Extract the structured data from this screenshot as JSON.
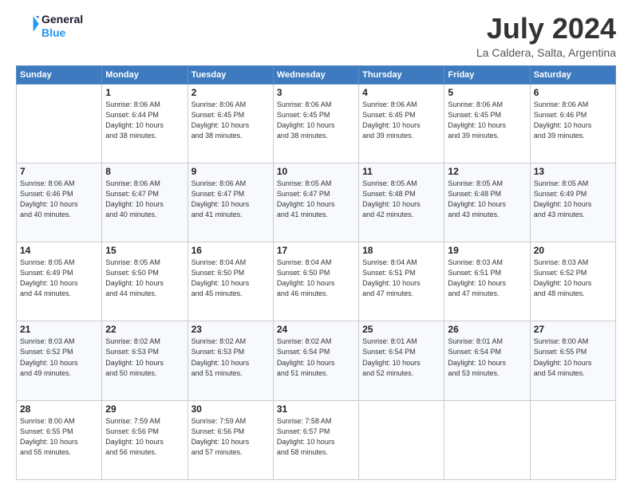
{
  "header": {
    "logo_line1": "General",
    "logo_line2": "Blue",
    "month_year": "July 2024",
    "location": "La Caldera, Salta, Argentina"
  },
  "weekdays": [
    "Sunday",
    "Monday",
    "Tuesday",
    "Wednesday",
    "Thursday",
    "Friday",
    "Saturday"
  ],
  "weeks": [
    [
      {
        "day": "",
        "sunrise": "",
        "sunset": "",
        "daylight": ""
      },
      {
        "day": "1",
        "sunrise": "Sunrise: 8:06 AM",
        "sunset": "Sunset: 6:44 PM",
        "daylight": "Daylight: 10 hours and 38 minutes."
      },
      {
        "day": "2",
        "sunrise": "Sunrise: 8:06 AM",
        "sunset": "Sunset: 6:45 PM",
        "daylight": "Daylight: 10 hours and 38 minutes."
      },
      {
        "day": "3",
        "sunrise": "Sunrise: 8:06 AM",
        "sunset": "Sunset: 6:45 PM",
        "daylight": "Daylight: 10 hours and 38 minutes."
      },
      {
        "day": "4",
        "sunrise": "Sunrise: 8:06 AM",
        "sunset": "Sunset: 6:45 PM",
        "daylight": "Daylight: 10 hours and 39 minutes."
      },
      {
        "day": "5",
        "sunrise": "Sunrise: 8:06 AM",
        "sunset": "Sunset: 6:45 PM",
        "daylight": "Daylight: 10 hours and 39 minutes."
      },
      {
        "day": "6",
        "sunrise": "Sunrise: 8:06 AM",
        "sunset": "Sunset: 6:46 PM",
        "daylight": "Daylight: 10 hours and 39 minutes."
      }
    ],
    [
      {
        "day": "7",
        "sunrise": "Sunrise: 8:06 AM",
        "sunset": "Sunset: 6:46 PM",
        "daylight": "Daylight: 10 hours and 40 minutes."
      },
      {
        "day": "8",
        "sunrise": "Sunrise: 8:06 AM",
        "sunset": "Sunset: 6:47 PM",
        "daylight": "Daylight: 10 hours and 40 minutes."
      },
      {
        "day": "9",
        "sunrise": "Sunrise: 8:06 AM",
        "sunset": "Sunset: 6:47 PM",
        "daylight": "Daylight: 10 hours and 41 minutes."
      },
      {
        "day": "10",
        "sunrise": "Sunrise: 8:05 AM",
        "sunset": "Sunset: 6:47 PM",
        "daylight": "Daylight: 10 hours and 41 minutes."
      },
      {
        "day": "11",
        "sunrise": "Sunrise: 8:05 AM",
        "sunset": "Sunset: 6:48 PM",
        "daylight": "Daylight: 10 hours and 42 minutes."
      },
      {
        "day": "12",
        "sunrise": "Sunrise: 8:05 AM",
        "sunset": "Sunset: 6:48 PM",
        "daylight": "Daylight: 10 hours and 43 minutes."
      },
      {
        "day": "13",
        "sunrise": "Sunrise: 8:05 AM",
        "sunset": "Sunset: 6:49 PM",
        "daylight": "Daylight: 10 hours and 43 minutes."
      }
    ],
    [
      {
        "day": "14",
        "sunrise": "Sunrise: 8:05 AM",
        "sunset": "Sunset: 6:49 PM",
        "daylight": "Daylight: 10 hours and 44 minutes."
      },
      {
        "day": "15",
        "sunrise": "Sunrise: 8:05 AM",
        "sunset": "Sunset: 6:50 PM",
        "daylight": "Daylight: 10 hours and 44 minutes."
      },
      {
        "day": "16",
        "sunrise": "Sunrise: 8:04 AM",
        "sunset": "Sunset: 6:50 PM",
        "daylight": "Daylight: 10 hours and 45 minutes."
      },
      {
        "day": "17",
        "sunrise": "Sunrise: 8:04 AM",
        "sunset": "Sunset: 6:50 PM",
        "daylight": "Daylight: 10 hours and 46 minutes."
      },
      {
        "day": "18",
        "sunrise": "Sunrise: 8:04 AM",
        "sunset": "Sunset: 6:51 PM",
        "daylight": "Daylight: 10 hours and 47 minutes."
      },
      {
        "day": "19",
        "sunrise": "Sunrise: 8:03 AM",
        "sunset": "Sunset: 6:51 PM",
        "daylight": "Daylight: 10 hours and 47 minutes."
      },
      {
        "day": "20",
        "sunrise": "Sunrise: 8:03 AM",
        "sunset": "Sunset: 6:52 PM",
        "daylight": "Daylight: 10 hours and 48 minutes."
      }
    ],
    [
      {
        "day": "21",
        "sunrise": "Sunrise: 8:03 AM",
        "sunset": "Sunset: 6:52 PM",
        "daylight": "Daylight: 10 hours and 49 minutes."
      },
      {
        "day": "22",
        "sunrise": "Sunrise: 8:02 AM",
        "sunset": "Sunset: 6:53 PM",
        "daylight": "Daylight: 10 hours and 50 minutes."
      },
      {
        "day": "23",
        "sunrise": "Sunrise: 8:02 AM",
        "sunset": "Sunset: 6:53 PM",
        "daylight": "Daylight: 10 hours and 51 minutes."
      },
      {
        "day": "24",
        "sunrise": "Sunrise: 8:02 AM",
        "sunset": "Sunset: 6:54 PM",
        "daylight": "Daylight: 10 hours and 51 minutes."
      },
      {
        "day": "25",
        "sunrise": "Sunrise: 8:01 AM",
        "sunset": "Sunset: 6:54 PM",
        "daylight": "Daylight: 10 hours and 52 minutes."
      },
      {
        "day": "26",
        "sunrise": "Sunrise: 8:01 AM",
        "sunset": "Sunset: 6:54 PM",
        "daylight": "Daylight: 10 hours and 53 minutes."
      },
      {
        "day": "27",
        "sunrise": "Sunrise: 8:00 AM",
        "sunset": "Sunset: 6:55 PM",
        "daylight": "Daylight: 10 hours and 54 minutes."
      }
    ],
    [
      {
        "day": "28",
        "sunrise": "Sunrise: 8:00 AM",
        "sunset": "Sunset: 6:55 PM",
        "daylight": "Daylight: 10 hours and 55 minutes."
      },
      {
        "day": "29",
        "sunrise": "Sunrise: 7:59 AM",
        "sunset": "Sunset: 6:56 PM",
        "daylight": "Daylight: 10 hours and 56 minutes."
      },
      {
        "day": "30",
        "sunrise": "Sunrise: 7:59 AM",
        "sunset": "Sunset: 6:56 PM",
        "daylight": "Daylight: 10 hours and 57 minutes."
      },
      {
        "day": "31",
        "sunrise": "Sunrise: 7:58 AM",
        "sunset": "Sunset: 6:57 PM",
        "daylight": "Daylight: 10 hours and 58 minutes."
      },
      {
        "day": "",
        "sunrise": "",
        "sunset": "",
        "daylight": ""
      },
      {
        "day": "",
        "sunrise": "",
        "sunset": "",
        "daylight": ""
      },
      {
        "day": "",
        "sunrise": "",
        "sunset": "",
        "daylight": ""
      }
    ]
  ]
}
